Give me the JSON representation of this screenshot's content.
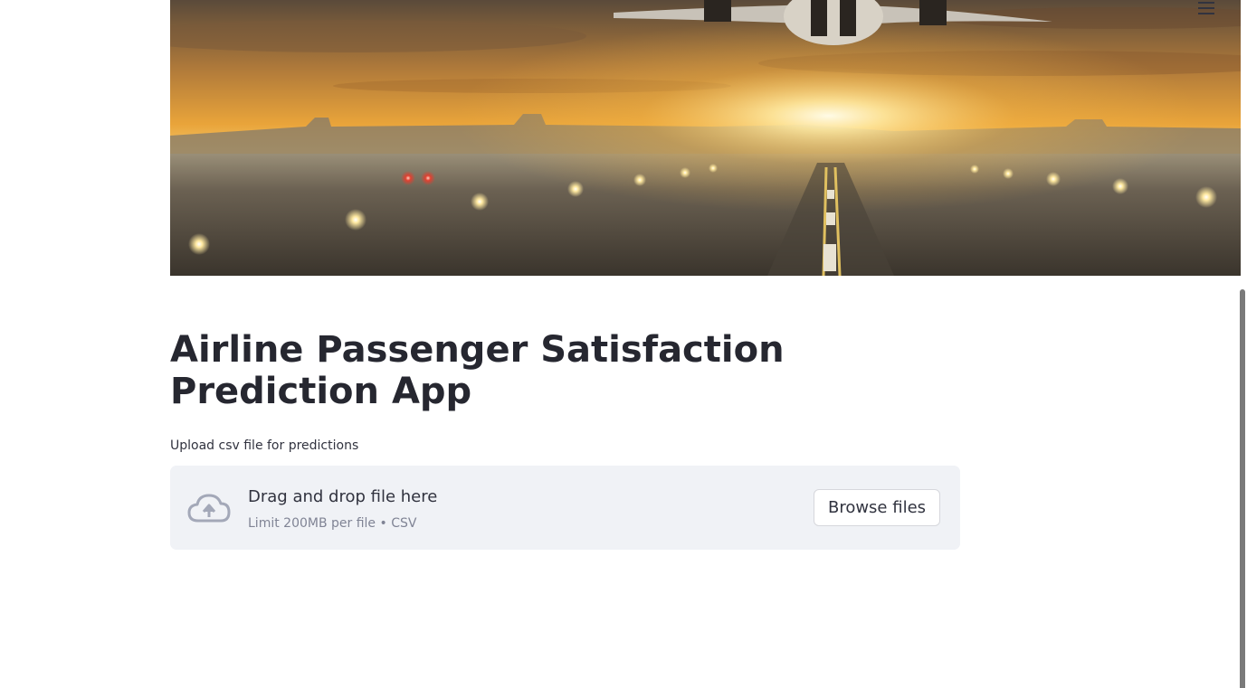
{
  "hero": {
    "image_description_icon": "airport-runway-sunset-image"
  },
  "header": {
    "menu_icon": "hamburger-menu-icon"
  },
  "main": {
    "title": "Airline Passenger Satisfaction Prediction App",
    "upload_label": "Upload csv file for predictions",
    "dropzone": {
      "icon": "cloud-upload-icon",
      "main_text": "Drag and drop file here",
      "sub_text": "Limit 200MB per file • CSV",
      "browse_label": "Browse files"
    }
  },
  "colors": {
    "text": "#262730",
    "dropzone_bg": "#f0f2f6",
    "muted": "#808495"
  }
}
